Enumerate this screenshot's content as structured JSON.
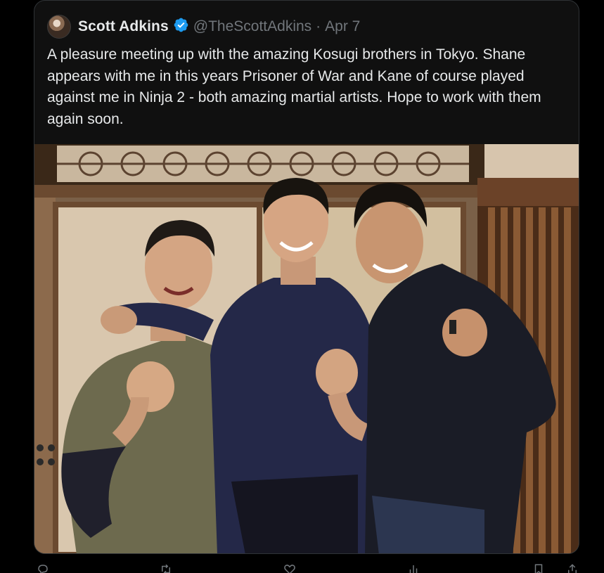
{
  "tweet": {
    "display_name": "Scott Adkins",
    "verified": true,
    "handle": "@TheScottAdkins",
    "separator": "·",
    "date": "Apr 7",
    "text": "A pleasure meeting up with the amazing Kosugi brothers in Tokyo. Shane appears with me in this years Prisoner of War and Kane of course played against me in Ninja 2 - both amazing martial artists. Hope to work with them again soon."
  },
  "icons": {
    "verified": "verified-badge-icon",
    "reply": "reply-icon",
    "retweet": "retweet-icon",
    "like": "heart-icon",
    "views": "views-icon",
    "bookmark": "bookmark-icon",
    "share": "share-icon"
  },
  "colors": {
    "background": "#000000",
    "card": "#101010",
    "border": "#2f3336",
    "text": "#e7e9ea",
    "muted": "#71767b",
    "verified_blue": "#1d9bf0"
  }
}
